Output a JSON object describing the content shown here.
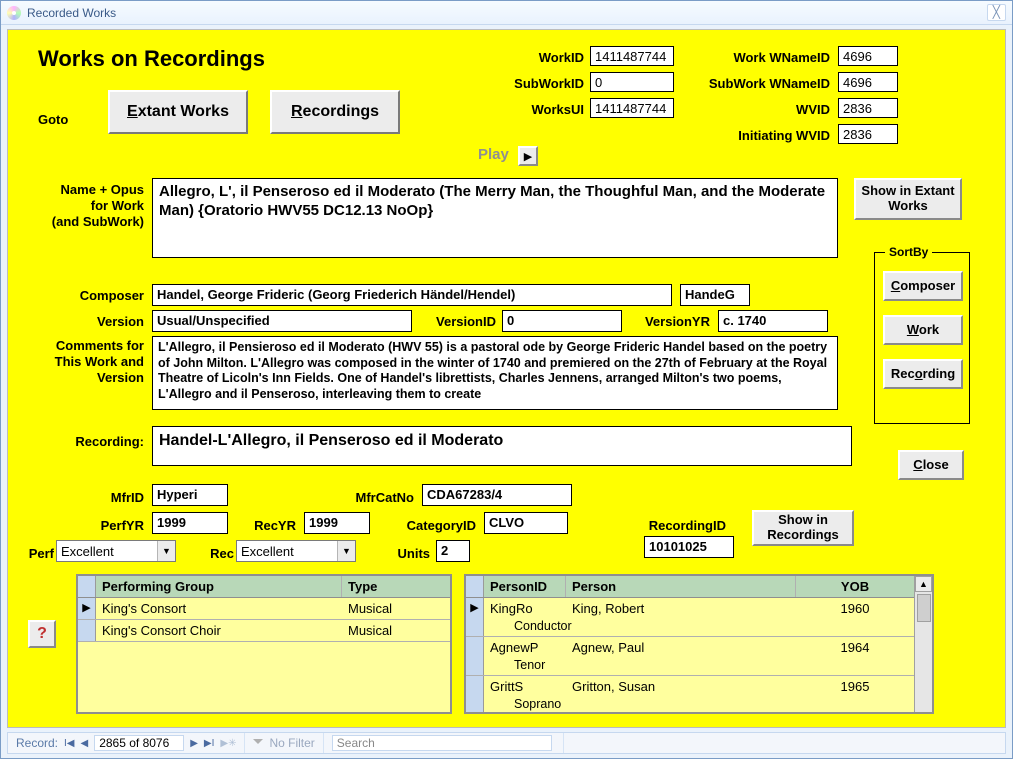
{
  "window": {
    "title": "Recorded Works"
  },
  "header": "Works on Recordings",
  "goto": {
    "label": "Goto",
    "extant": "Extant Works",
    "recordings": "Recordings"
  },
  "play": {
    "label": "Play"
  },
  "ids": {
    "workid_label": "WorkID",
    "workid": "1411487744",
    "subworkid_label": "SubWorkID",
    "subworkid": "0",
    "worksui_label": "WorksUI",
    "worksui": "1411487744",
    "wnameid_label": "Work WNameID",
    "wnameid": "4696",
    "subwnameid_label": "SubWork WNameID",
    "subwnameid": "4696",
    "wvid_label": "WVID",
    "wvid": "2836",
    "initwvid_label": "Initiating WVID",
    "initwvid": "2836"
  },
  "name_opus": {
    "label1": "Name + Opus",
    "label2": "for Work",
    "label3": "(and SubWork)",
    "value": "Allegro, L', il Penseroso ed il Moderato (The Merry Man, the Thoughful Man, and the Moderate Man) {Oratorio HWV55 DC12.13 NoOp}"
  },
  "show_extant": "Show in Extant Works",
  "composer": {
    "label": "Composer",
    "value": "Handel, George Frideric (Georg Friederich Händel/Hendel)",
    "short": "HandeG"
  },
  "version": {
    "label": "Version",
    "value": "Usual/Unspecified",
    "versionid_label": "VersionID",
    "versionid": "0",
    "versionyr_label": "VersionYR",
    "versionyr": "c. 1740"
  },
  "comments": {
    "label1": "Comments for",
    "label2": "This Work and",
    "label3": "Version",
    "value": "L'Allegro, il Pensieroso ed il Moderato (HWV 55) is a pastoral ode by George Frideric Handel based on the poetry of John Milton. L'Allegro was composed in the winter of 1740 and premiered on the 27th of February at the Royal Theatre of Licoln's Inn Fields. One of Handel's librettists, Charles Jennens, arranged Milton's two poems, L'Allegro and il Penseroso, interleaving them to create"
  },
  "sortby": {
    "legend": "SortBy",
    "composer": "Composer",
    "work": "Work",
    "recording": "Recording"
  },
  "close": "Close",
  "recording": {
    "label": "Recording:",
    "value": "Handel-L'Allegro, il Penseroso ed il Moderato"
  },
  "mfr": {
    "mfrid_label": "MfrID",
    "mfrid": "Hyperi",
    "mfrcatno_label": "MfrCatNo",
    "mfrcatno": "CDA67283/4"
  },
  "rec": {
    "perfyr_label": "PerfYR",
    "perfyr": "1999",
    "recyr_label": "RecYR",
    "recyr": "1999",
    "categoryid_label": "CategoryID",
    "categoryid": "CLVO",
    "recordingid_label": "RecordingID",
    "recordingid": "10101025",
    "perf_label": "Perf",
    "perf": "Excellent",
    "rec_label": "Rec",
    "recq": "Excellent",
    "units_label": "Units",
    "units": "2"
  },
  "show_rec": "Show in Recordings",
  "help": "?",
  "grid1": {
    "h1": "Performing Group",
    "h2": "Type",
    "rows": [
      {
        "group": "King's Consort",
        "type": "Musical"
      },
      {
        "group": "King's Consort Choir",
        "type": "Musical"
      }
    ]
  },
  "grid2": {
    "h1": "PersonID",
    "h2": "Person",
    "h3": "YOB",
    "rows": [
      {
        "pid": "KingRo",
        "person": "King, Robert",
        "role": "Conductor",
        "yob": "1960"
      },
      {
        "pid": "AgnewP",
        "person": "Agnew, Paul",
        "role": "Tenor",
        "yob": "1964"
      },
      {
        "pid": "GrittS",
        "person": "Gritton, Susan",
        "role": "Soprano",
        "yob": "1965"
      }
    ]
  },
  "recordnav": {
    "label": "Record:",
    "pos": "2865 of 8076",
    "nofilter": "No Filter",
    "search": "Search"
  }
}
